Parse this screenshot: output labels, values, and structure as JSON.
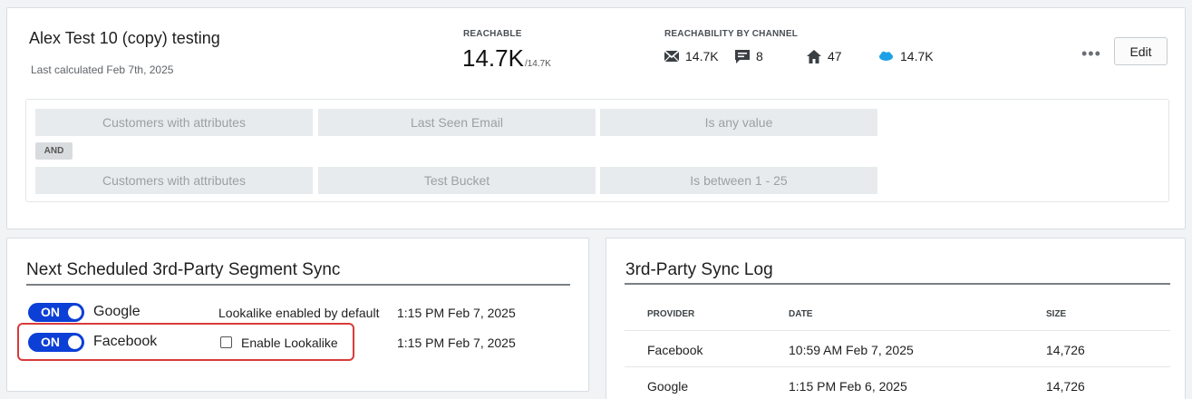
{
  "segment": {
    "title": "Alex Test 10 (copy) testing",
    "last_calculated": "Last calculated Feb 7th, 2025",
    "reachable_label": "REACHABLE",
    "reachable_value": "14.7K",
    "reachable_total": "/14.7K",
    "channel_label": "REACHABILITY BY CHANNEL",
    "channels": [
      {
        "icon": "email-icon",
        "value": "14.7K"
      },
      {
        "icon": "sms-icon",
        "value": "8"
      },
      {
        "icon": "home-icon",
        "value": "47"
      },
      {
        "icon": "salesforce-icon",
        "value": "14.7K"
      }
    ],
    "more_label": "•••",
    "edit_label": "Edit"
  },
  "rules": {
    "row1": [
      "Customers with attributes",
      "Last Seen Email",
      "Is any value"
    ],
    "and_label": "AND",
    "row2": [
      "Customers with attributes",
      "Test Bucket",
      "Is between 1 - 25"
    ]
  },
  "sync": {
    "title": "Next Scheduled 3rd-Party Segment Sync",
    "rows": [
      {
        "toggle": "ON",
        "provider": "Google",
        "note": "Lookalike enabled by default",
        "time": "1:15 PM Feb 7, 2025"
      },
      {
        "toggle": "ON",
        "provider": "Facebook",
        "checkbox_label": "Enable Lookalike",
        "time": "1:15 PM Feb 7, 2025"
      }
    ]
  },
  "log": {
    "title": "3rd-Party Sync Log",
    "headers": [
      "PROVIDER",
      "DATE",
      "SIZE"
    ],
    "rows": [
      {
        "provider": "Facebook",
        "date": "10:59 AM Feb 7, 2025",
        "size": "14,726"
      },
      {
        "provider": "Google",
        "date": "1:15 PM Feb 6, 2025",
        "size": "14,726"
      }
    ]
  },
  "colors": {
    "toggle_on": "#0b3fd6",
    "highlight": "#d93b3b",
    "salesforce": "#1da1e6"
  }
}
